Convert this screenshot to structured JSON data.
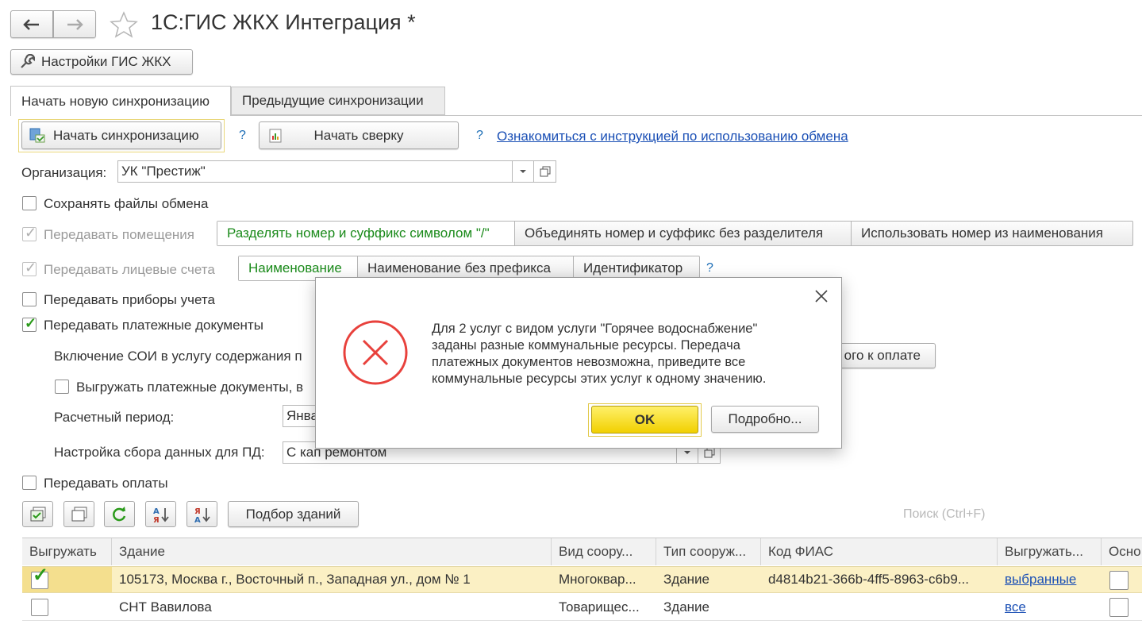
{
  "window": {
    "title": "1С:ГИС ЖКХ Интеграция *",
    "back_icon": "arrow-left-icon",
    "forward_icon": "arrow-right-icon",
    "favorite_icon": "star-icon"
  },
  "settings_button": "Настройки ГИС ЖКХ",
  "tabs": [
    {
      "label": "Начать новую синхронизацию",
      "active": true
    },
    {
      "label": "Предыдущие синхронизации",
      "active": false
    }
  ],
  "actions": {
    "start_sync": "Начать синхронизацию",
    "help1": "?",
    "start_reconcile": "Начать сверку",
    "help2": "?",
    "instruction_link": "Ознакомиться с инструкцией по использованию обмена"
  },
  "org": {
    "label": "Организация:",
    "value": "УК \"Престиж\""
  },
  "options": {
    "save_files": "Сохранять файлы обмена",
    "premises": "Передавать помещения",
    "premises_modes": [
      "Разделять номер и суффикс символом \"/\"",
      "Объединять номер и суффикс без разделителя",
      "Использовать номер из наименования"
    ],
    "accounts": "Передавать лицевые счета",
    "accounts_modes": [
      "Наименование",
      "Наименование без префикса",
      "Идентификатор"
    ],
    "accounts_help": "?",
    "meters": "Передавать приборы учета",
    "payment_docs": "Передавать платежные документы",
    "soi_label": "Включение СОИ в услугу содержания п",
    "soi_button_tail": "ого к оплате",
    "export_docs": "Выгружать платежные документы, в",
    "period_label": "Расчетный период:",
    "period_value": "Янва",
    "collect_label": "Настройка сбора данных для ПД:",
    "collect_value": "С кап ремонтом",
    "payments": "Передавать оплаты"
  },
  "toolbar": {
    "select_buildings": "Подбор зданий",
    "search_placeholder": "Поиск (Ctrl+F)"
  },
  "table": {
    "columns": [
      "Выгружать",
      "Здание",
      "Вид соору...",
      "Тип сооруж...",
      "Код ФИАС",
      "Выгружать...",
      "Осно"
    ],
    "rows": [
      {
        "building": "105173, Москва г., Восточный п., Западная ул., дом № 1",
        "kind": "Многоквар...",
        "type": "Здание",
        "fias": "d4814b21-366b-4ff5-8963-c6b9...",
        "export_mode": "выбранные",
        "checked": true
      },
      {
        "building": "СНТ Вавилова",
        "kind": "Товарищес...",
        "type": "Здание",
        "fias": "",
        "export_mode": "все",
        "checked": false
      }
    ]
  },
  "dialog": {
    "message": "Для 2 услуг с видом услуги \"Горячее водоснабжение\" заданы разные коммунальные ресурсы. Передача платежных документов невозможна, приведите все коммунальные ресурсы этих услуг к одному значению.",
    "ok": "OK",
    "details": "Подробно...",
    "icon": "error-icon",
    "accent": "#e8413c"
  }
}
